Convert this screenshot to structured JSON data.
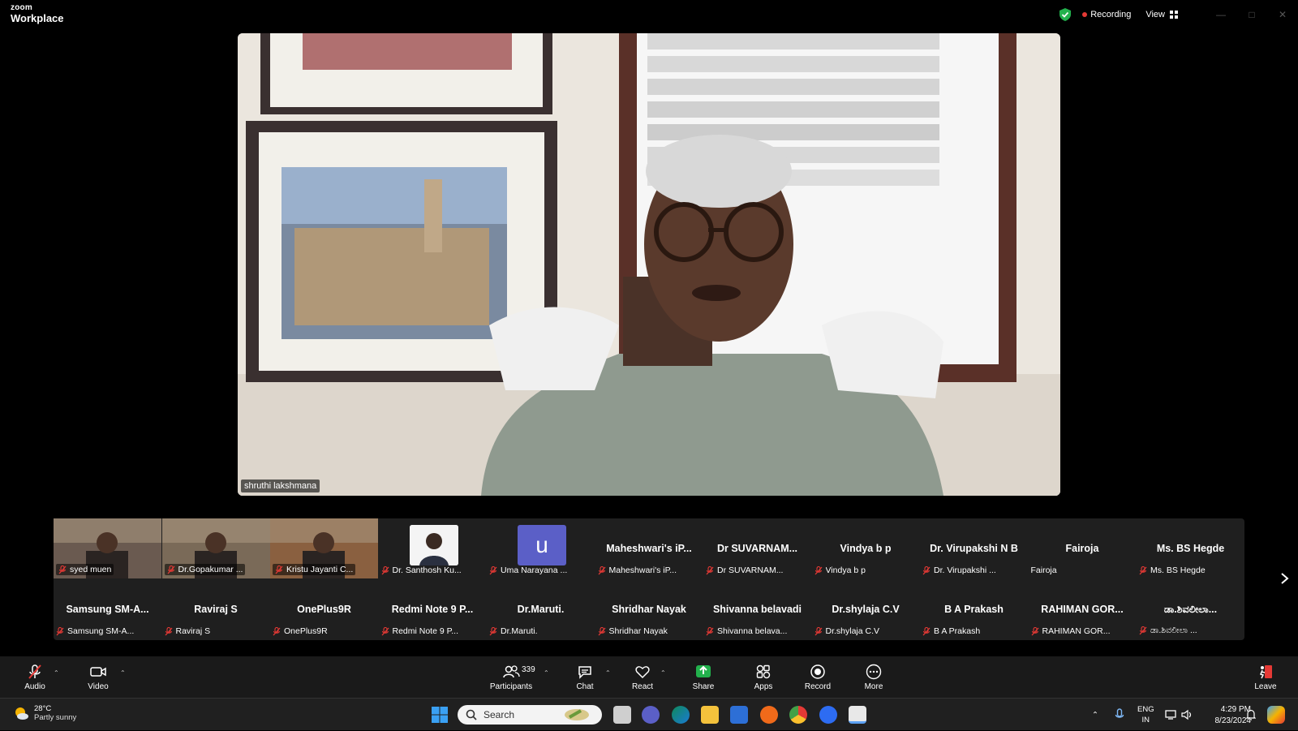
{
  "app": {
    "brand_top": "zoom",
    "brand_bottom": "Workplace"
  },
  "titlebar": {
    "recording_label": "Recording",
    "view_label": "View"
  },
  "main_video": {
    "speaker_name": "shruthi lakshmana"
  },
  "gallery": {
    "tiles": [
      {
        "label": "syed muen",
        "type": "video"
      },
      {
        "label": "Dr.Gopakumar ...",
        "type": "video"
      },
      {
        "label": "Kristu Jayanti C...",
        "type": "video"
      },
      {
        "label": "Dr. Santhosh Ku...",
        "type": "photo"
      },
      {
        "label": "Uma Narayana ...",
        "type": "avatar",
        "initial": "u"
      },
      {
        "title": "Maheshwari's iP...",
        "label": "Maheshwari's iP...",
        "type": "name"
      },
      {
        "title": "Dr SUVARNAM...",
        "label": "Dr SUVARNAM...",
        "type": "name"
      },
      {
        "title": "Vindya b p",
        "label": "Vindya b p",
        "type": "name"
      },
      {
        "title": "Dr. Virupakshi N B",
        "label": "Dr. Virupakshi ...",
        "type": "name"
      },
      {
        "title": "Fairoja",
        "label": "Fairoja",
        "type": "name",
        "unmuted": true
      },
      {
        "title": "Ms. BS Hegde",
        "label": "Ms. BS Hegde",
        "type": "name"
      },
      {
        "title": "Samsung SM-A...",
        "label": "Samsung SM-A...",
        "type": "name"
      },
      {
        "title": "Raviraj S",
        "label": "Raviraj S",
        "type": "name"
      },
      {
        "title": "OnePlus9R",
        "label": "OnePlus9R",
        "type": "name"
      },
      {
        "title": "Redmi Note 9 P...",
        "label": "Redmi Note 9 P...",
        "type": "name"
      },
      {
        "title": "Dr.Maruti.",
        "label": "Dr.Maruti.",
        "type": "name"
      },
      {
        "title": "Shridhar Nayak",
        "label": "Shridhar Nayak",
        "type": "name"
      },
      {
        "title": "Shivanna belavadi",
        "label": "Shivanna belava...",
        "type": "name"
      },
      {
        "title": "Dr.shylaja C.V",
        "label": "Dr.shylaja C.V",
        "type": "name"
      },
      {
        "title": "B A Prakash",
        "label": "B A Prakash",
        "type": "name"
      },
      {
        "title": "RAHIMAN GOR...",
        "label": "RAHIMAN GOR...",
        "type": "name"
      },
      {
        "title": "ಡಾ.ಶಿವಲೀಲಾ...",
        "label": "ಡಾ.ಶಿವಲೀಲಾ ...",
        "type": "name"
      }
    ]
  },
  "toolbar": {
    "audio": "Audio",
    "video": "Video",
    "participants": "Participants",
    "participants_count": "339",
    "chat": "Chat",
    "react": "React",
    "share": "Share",
    "apps": "Apps",
    "record": "Record",
    "more": "More",
    "leave": "Leave",
    "colors": {
      "share": "#22b14c",
      "leave": "#e53935"
    }
  },
  "taskbar": {
    "temp": "28°C",
    "weather": "Partly sunny",
    "search_placeholder": "Search",
    "lang1": "ENG",
    "lang2": "IN",
    "time": "4:29 PM",
    "date": "8/23/2024"
  }
}
